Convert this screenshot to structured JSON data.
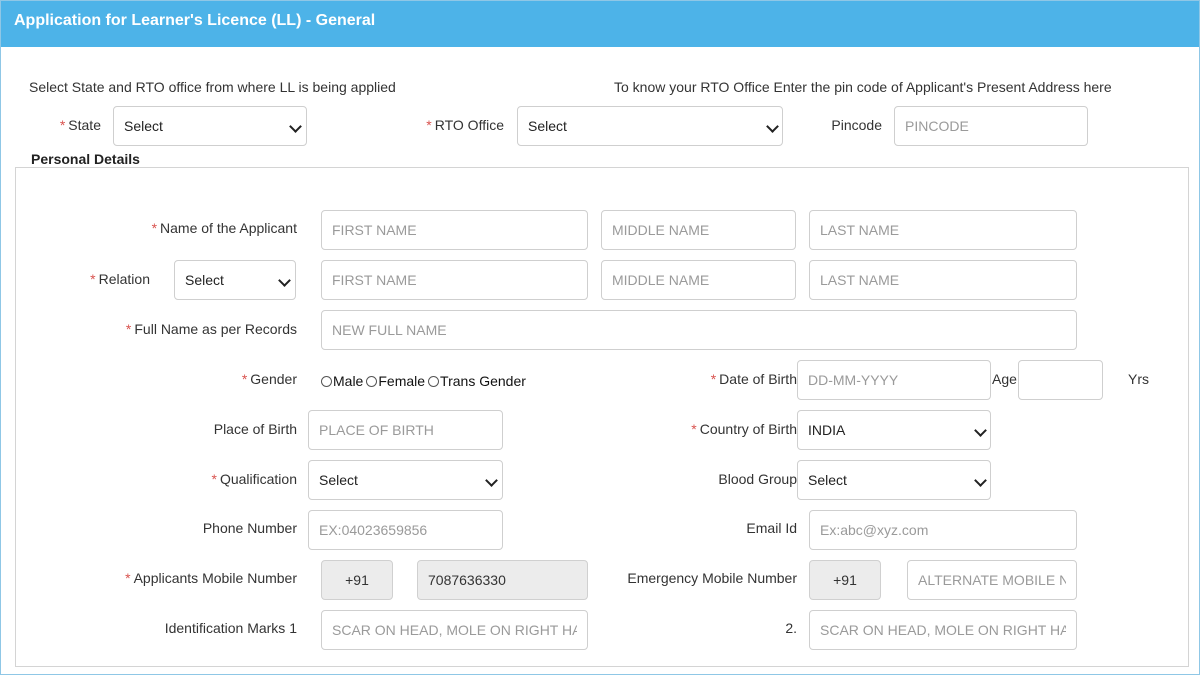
{
  "header": {
    "title": "Application for Learner's Licence (LL) - General"
  },
  "top": {
    "left_note": "Select State and RTO office from where LL is being applied",
    "right_note": "To know your RTO Office Enter the pin code of Applicant's Present Address here",
    "state_label": "State",
    "state_value": "Select",
    "rto_label": "RTO Office",
    "rto_value": "Select",
    "pincode_label": "Pincode",
    "pincode_placeholder": "PINCODE"
  },
  "personal": {
    "legend": "Personal Details",
    "required_mark": "*",
    "name_label": "Name of the Applicant",
    "first_name_placeholder": "FIRST NAME",
    "middle_name_placeholder": "MIDDLE NAME",
    "last_name_placeholder": "LAST NAME",
    "relation_label": "Relation",
    "relation_value": "Select",
    "full_name_label": "Full Name as per Records",
    "full_name_placeholder": "NEW FULL NAME",
    "gender_label": "Gender",
    "gender_options": [
      "Male",
      "Female",
      "Trans Gender"
    ],
    "dob_label": "Date of Birth",
    "dob_placeholder": "DD-MM-YYYY",
    "age_label": "Age",
    "yrs_label": "Yrs",
    "pob_label": "Place of Birth",
    "pob_placeholder": "PLACE OF BIRTH",
    "country_label": "Country of Birth",
    "country_value": "INDIA",
    "qualification_label": "Qualification",
    "qualification_value": "Select",
    "blood_label": "Blood Group",
    "blood_value": "Select",
    "phone_label": "Phone Number",
    "phone_placeholder": "EX:04023659856",
    "email_label": "Email Id",
    "email_placeholder": "Ex:abc@xyz.com",
    "mobile_label": "Applicants Mobile Number",
    "mobile_code": "+91",
    "mobile_value": "7087636330",
    "emergency_label": "Emergency Mobile Number",
    "emergency_code": "+91",
    "emergency_placeholder": "ALTERNATE MOBILE NUMI",
    "id_marks_label": "Identification Marks 1",
    "id_marks_placeholder": "SCAR ON HEAD, MOLE ON RIGHT HAND, ET",
    "id_marks2_label": "2.",
    "id_marks2_placeholder": "SCAR ON HEAD, MOLE ON RIGHT HAND, ET"
  },
  "colors": {
    "header": "#4db3e8",
    "required": "#d9534f"
  }
}
